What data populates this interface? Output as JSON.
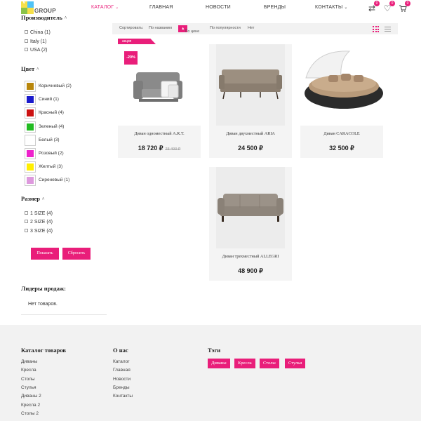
{
  "header": {
    "logo_letter": "V",
    "logo_text": "GROUP",
    "nav": [
      {
        "label": "КАТАЛОГ",
        "has_menu": true,
        "active": true
      },
      {
        "label": "ГЛАВНАЯ"
      },
      {
        "label": "НОВОСТИ"
      },
      {
        "label": "БРЕНДЫ"
      },
      {
        "label": "КОНТАКТЫ",
        "has_menu": true
      }
    ],
    "compare_count": "0",
    "favorites_count": "0",
    "cart_count": "0",
    "accent_color": "#e91e7a"
  },
  "filters": {
    "manufacturer_title": "Производитель",
    "manufacturers": [
      "China (1)",
      "Italy (1)",
      "USA (2)"
    ],
    "color_title": "Цвет",
    "colors": [
      {
        "label": "Коричневый (2)",
        "hex": "#b8860b"
      },
      {
        "label": "Синий (1)",
        "hex": "#1a1acc"
      },
      {
        "label": "Красный (4)",
        "hex": "#cc1111"
      },
      {
        "label": "Зеленый (4)",
        "hex": "#22bb22"
      },
      {
        "label": "Белый (3)",
        "hex": "#ffffff"
      },
      {
        "label": "Розовый (2)",
        "hex": "#ee22cc"
      },
      {
        "label": "Желтый (3)",
        "hex": "#ffee00"
      },
      {
        "label": "Сиреневый (1)",
        "hex": "#dd99dd"
      }
    ],
    "size_title": "Размер",
    "sizes": [
      "1 SIZE (4)",
      "2 SIZE (4)",
      "3 SIZE (4)"
    ],
    "show_button": "Показать",
    "reset_button": "Сбросить"
  },
  "leaders": {
    "title": "Лидеры продаж:",
    "empty": "Нет товаров."
  },
  "sortbar": {
    "label": "Сортировать:",
    "by_name": "По названию",
    "by_price": "По цене",
    "by_popularity": "По популярности",
    "no": "Нет"
  },
  "products": [
    {
      "name": "Диван одноместный A.R.T.",
      "price": "18 720 ₽",
      "old_price": "23 400 ₽",
      "discount": "-20%",
      "promo": "акция"
    },
    {
      "name": "Диван двухместный ARIA",
      "price": "24 500 ₽"
    },
    {
      "name": "Диван CARACOLE",
      "price": "32 500 ₽"
    },
    {
      "name": "Диван трехместный ALLEGRI",
      "price": "48 900 ₽"
    }
  ],
  "footer": {
    "catalog_title": "Каталог товаров",
    "catalog_links": [
      "Диваны",
      "Кресла",
      "Столы",
      "Стулья",
      "Диваны 2",
      "Кресла 2",
      "Столы 2"
    ],
    "about_title": "О нас",
    "about_links": [
      "Каталог",
      "Главная",
      "Новости",
      "Бренды",
      "Контакты"
    ],
    "tags_title": "Тэги",
    "tags": [
      "Диваны",
      "Кресла",
      "Столы",
      "Стулья"
    ]
  }
}
